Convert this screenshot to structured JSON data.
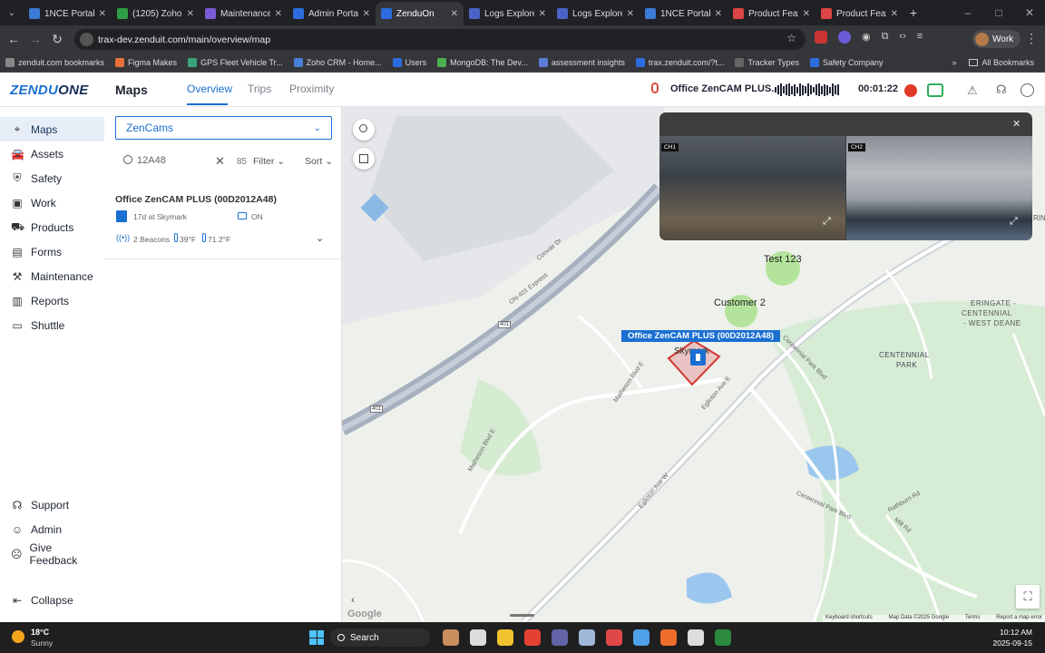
{
  "browser": {
    "tabs": [
      {
        "title": "1NCE Portal |",
        "color": "#3a7bd5"
      },
      {
        "title": "(1205) Zoho",
        "color": "#2e9e47"
      },
      {
        "title": "Maintenance",
        "color": "#7b5cd6"
      },
      {
        "title": "Admin Portal",
        "color": "#2d6cdf"
      },
      {
        "title": "ZenduOn",
        "color": "#2d6cdf",
        "active": true
      },
      {
        "title": "Logs Explore",
        "color": "#4a63c8"
      },
      {
        "title": "Logs Explore",
        "color": "#4a63c8"
      },
      {
        "title": "1NCE Portal",
        "color": "#3a7bd5"
      },
      {
        "title": "Product Feat",
        "color": "#d44"
      },
      {
        "title": "Product Feat",
        "color": "#d44"
      }
    ],
    "url": "trax-dev.zenduit.com/main/overview/map",
    "profile": "Work",
    "bookmarks": [
      "zenduit.com bookmarks",
      "Figma Makes",
      "GPS Fleet Vehicle Tr...",
      "Zoho CRM - Home...",
      "Users",
      "MongoDB: The Dev...",
      "assessment insights",
      "trax.zenduit.com/?t...",
      "Tracker Types",
      "Safety Company"
    ],
    "all_bookmarks": "All Bookmarks"
  },
  "app": {
    "logo_a": "ZENDU",
    "logo_b": "ONE",
    "section": "Maps",
    "tabs": [
      "Overview",
      "Trips",
      "Proximity"
    ],
    "call_device": "Office ZenCAM PLUS...",
    "call_timer": "00:01:22"
  },
  "sidebar": {
    "items": [
      {
        "label": "Maps",
        "icon": "pin"
      },
      {
        "label": "Assets",
        "icon": "car"
      },
      {
        "label": "Safety",
        "icon": "shield"
      },
      {
        "label": "Work",
        "icon": "briefcase"
      },
      {
        "label": "Products",
        "icon": "truck"
      },
      {
        "label": "Forms",
        "icon": "doc"
      },
      {
        "label": "Maintenance",
        "icon": "wrench"
      },
      {
        "label": "Reports",
        "icon": "report"
      },
      {
        "label": "Shuttle",
        "icon": "bus"
      }
    ],
    "bottom": [
      {
        "label": "Support",
        "icon": "support"
      },
      {
        "label": "Admin",
        "icon": "admin"
      },
      {
        "label": "Give Feedback",
        "icon": "feedback"
      }
    ],
    "collapse": "Collapse"
  },
  "panel": {
    "dropdown": "ZenCams",
    "search_value": "12A48",
    "count": "85",
    "filter": "Filter",
    "sort": "Sort",
    "device": {
      "name": "Office ZenCAM PLUS (00D2012A48)",
      "location": "17d at Skymark",
      "status": "ON",
      "beacons": "2 Beacons",
      "temp1": "39°F",
      "temp2": "71.2°F"
    }
  },
  "map": {
    "labels": {
      "test123": "Test 123",
      "customer2": "Customer 2",
      "device_label": "Office ZenCAM PLUS (00D2012A48)",
      "skymark": "Skymark",
      "eringate": "ERINGATE -",
      "centennial_wd": "CENTENNIAL",
      "west_deane": "- WEST DEANE",
      "centennial_park": "CENTENNIAL",
      "park": "PARK",
      "hwy401a": "401",
      "hwy401b": "401",
      "conver": "Convair Dr",
      "matheson": "Matheson Blvd E",
      "matheson2": "Matheson Blvd E",
      "eglinton": "Eglinton Ave E",
      "eglinton2": "Eglinton Ave W",
      "cpb": "Centennial Park Blvd",
      "cpb2": "Centennial Park Blvd",
      "rathburn": "Rathburn Rd",
      "mill": "Mill Rd",
      "express": "ON-401 Express",
      "edge_right": "RIN"
    },
    "video": {
      "ch1": "CH1",
      "ch2": "CH2"
    },
    "footer": [
      "Keyboard shortcuts",
      "Map Data ©2025 Google",
      "Terms",
      "Report a map error"
    ],
    "google": "Google"
  },
  "taskbar": {
    "temp": "18°C",
    "weather": "Sunny",
    "search": "Search",
    "time": "10:12 AM",
    "date": "2025-09-15"
  }
}
